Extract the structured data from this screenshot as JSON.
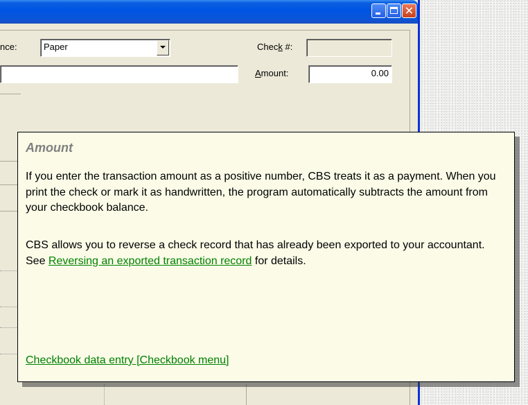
{
  "window": {
    "buttons": {
      "minimize_icon": "minimize-icon",
      "maximize_icon": "maximize-icon",
      "close_icon": "close-icon"
    }
  },
  "form": {
    "source_label_partial": "nce:",
    "source_value": "Paper",
    "check_label": "Check #:",
    "check_value": "",
    "payee_value": "",
    "amount_label": "Amount:",
    "amount_value": "0.00"
  },
  "popup": {
    "title": "Amount",
    "para1": "If you enter the transaction amount as a positive number, CBS treats it as a payment. When you print the check or mark it as handwritten, the program automatically subtracts the amount from your checkbook balance.",
    "para2_text": "CBS allows you to reverse a check record that has already been exported to your accountant. See ",
    "para2_link": "Reversing an exported transaction record",
    "para2_suffix": " for details.",
    "related_link": "Checkbook data entry [Checkbook menu]",
    "link_color": "#008000"
  }
}
